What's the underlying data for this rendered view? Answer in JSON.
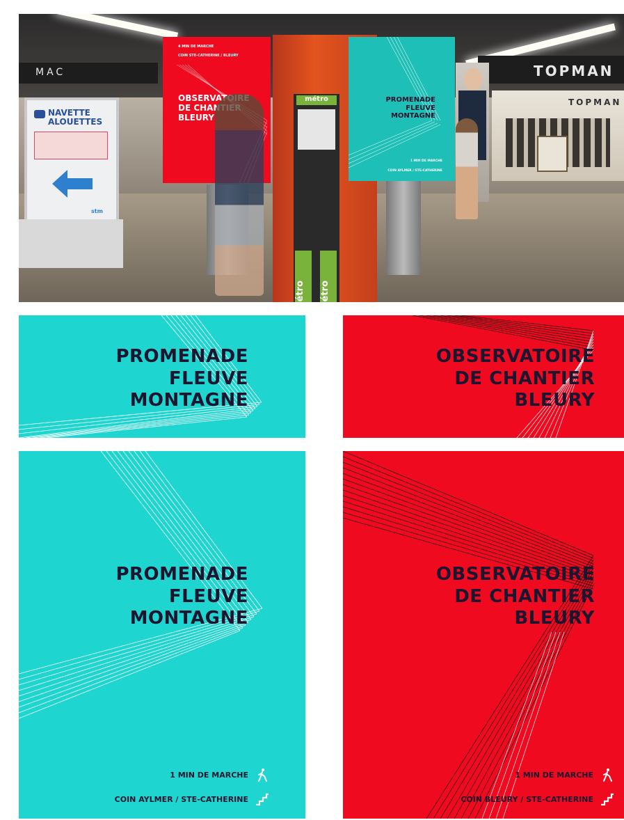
{
  "photo": {
    "store_sign_left": "MAC",
    "store_sign_right": "TOPMAN",
    "store_sign_right_2": "TOPMAN",
    "navette_sign": {
      "line1": "NAVETTE",
      "line2": "ALOUETTES",
      "footer": "stm"
    },
    "kiosk_label": "métro",
    "sign_red": {
      "top_line1": "4 MIN DE MARCHE",
      "top_line2": "COIN STE-CATHERINE / BLEURY",
      "title": [
        "OBSERVATOIRE",
        "DE CHANTIER",
        "BLEURY"
      ]
    },
    "sign_teal": {
      "title": [
        "PROMENADE",
        "FLEUVE",
        "MONTAGNE"
      ],
      "bottom_line1": "1 MIN DE MARCHE",
      "bottom_line2": "COIN AYLMER / STE-CATHERINE"
    }
  },
  "panels": {
    "teal_small": {
      "title": [
        "PROMENADE",
        "FLEUVE",
        "MONTAGNE"
      ]
    },
    "red_small": {
      "title": [
        "OBSERVATOIRE",
        "DE CHANTIER",
        "BLEURY"
      ]
    },
    "teal_large": {
      "title": [
        "PROMENADE",
        "FLEUVE",
        "MONTAGNE"
      ],
      "walk_time": "1 MIN DE MARCHE",
      "location": "COIN AYLMER / STE-CATHERINE"
    },
    "red_large": {
      "title": [
        "OBSERVATOIRE",
        "DE CHANTIER",
        "BLEURY"
      ],
      "walk_time": "1 MIN DE MARCHE",
      "location": "COIN BLEURY / STE-CATHERINE"
    }
  },
  "colors": {
    "teal": "#1ed6cf",
    "red": "#f00a20",
    "ink": "#1c1530"
  },
  "icons": {
    "walk": "pedestrian-icon",
    "stairs": "stairs-icon"
  }
}
